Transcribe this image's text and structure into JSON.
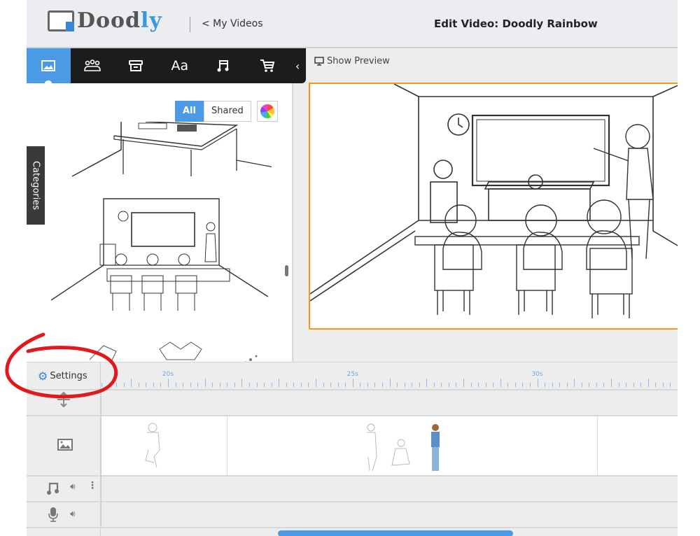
{
  "header": {
    "logo_main": "Dood",
    "logo_accent": "ly",
    "back_link": "< My Videos",
    "title": "Edit Video: Doodly Rainbow"
  },
  "toolbar": {
    "tabs": [
      {
        "name": "images",
        "icon": "image-icon",
        "glyph": "🖼",
        "active": true
      },
      {
        "name": "characters",
        "icon": "characters-icon",
        "glyph": "👥"
      },
      {
        "name": "props",
        "icon": "box-icon",
        "glyph": "⊟"
      },
      {
        "name": "text",
        "icon": "text-icon",
        "glyph": "Aa"
      },
      {
        "name": "music",
        "icon": "music-icon",
        "glyph": "♫"
      },
      {
        "name": "store",
        "icon": "cart-icon",
        "glyph": "🛒"
      }
    ],
    "collapse_glyph": "‹"
  },
  "library": {
    "filter_all": "All",
    "filter_shared": "Shared",
    "categories_label": "Categories"
  },
  "preview": {
    "show_preview_label": "Show Preview"
  },
  "timeline": {
    "settings_label": "Settings",
    "ruler_labels": [
      {
        "label": "20s",
        "seconds": 20
      },
      {
        "label": "25s",
        "seconds": 25
      },
      {
        "label": "30s",
        "seconds": 30
      }
    ],
    "visible_start_seconds": 18.2,
    "visible_end_seconds": 33.8,
    "tracks": [
      {
        "name": "move",
        "icon": "move-icon"
      },
      {
        "name": "image",
        "icon": "image-icon"
      },
      {
        "name": "music",
        "icon": "music-icon"
      },
      {
        "name": "voice",
        "icon": "microphone-icon"
      }
    ]
  },
  "colors": {
    "accent": "#4a9ae6",
    "selection": "#f7961e",
    "annotation": "#e0191e"
  }
}
